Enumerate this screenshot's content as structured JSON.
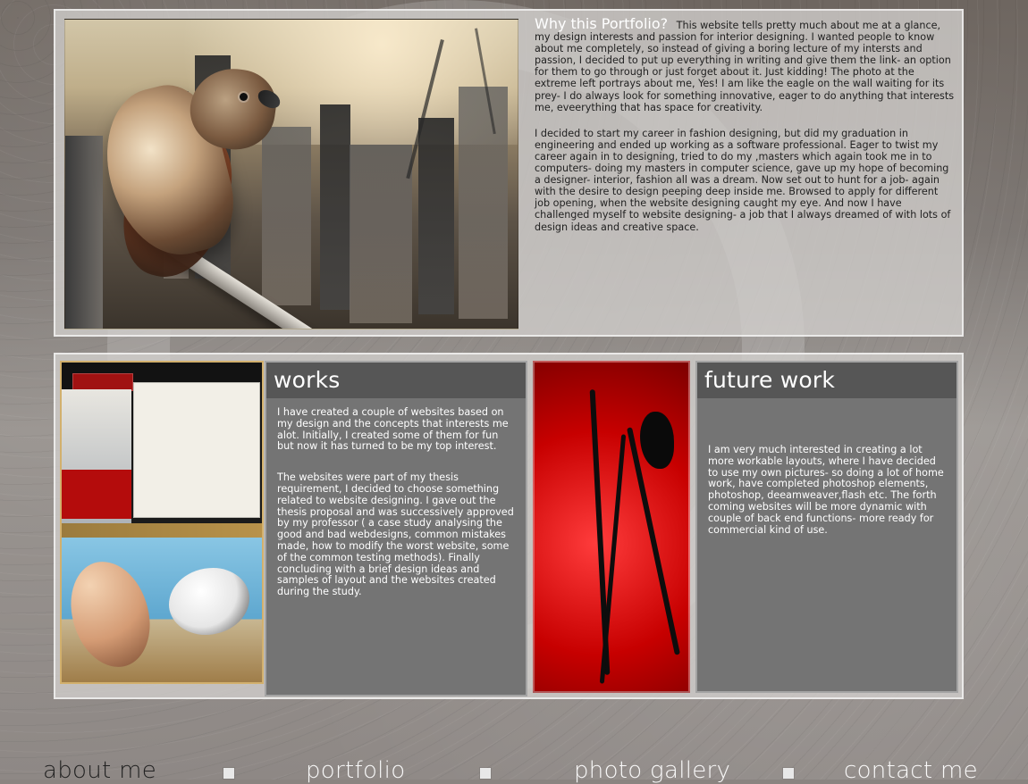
{
  "top": {
    "heading": "Why this Portfolio?",
    "para1": "This website tells pretty much about me at a glance, my design interests and passion for interior designing. I wanted people to know about me completely, so instead of giving a boring lecture of my intersts and passion, I decided to put up everything in writing and give them the link- an option for them to go through or just forget about it. Just kidding! The photo at the extreme left portrays about me, Yes! I am like the eagle on the wall waiting for its prey- I do always look for something innovative, eager to do anything that interests me, eveerything that has space for creativity.",
    "para2": "I decided to start my career in fashion designing, but did my graduation in engineering and ended up working as a software professional. Eager to twist my career again in to designing, tried to do my ,masters which again took me in to computers- doing my masters in computer science, gave up my hope of becoming a designer- interior, fashion all was a dream. Now set out to hunt for a job- again with the desire to design peeping deep inside me. Browsed to apply for different job opening, when the website designing caught my eye. And now I have challenged myself to website designing- a job that I always dreamed of with lots of design ideas and creative space."
  },
  "works": {
    "title": "works",
    "para1": "I have created a couple of websites based on my design and the concepts that interests me alot. Initially, I created some of them for fun but now it has turned to be my top interest.",
    "para2": "The websites were part of my thesis requirement, I decided to choose something related to website designing. I gave out the thesis proposal and was successively approved by my professor ( a case study analysing the good and bad webdesigns, common mistakes made, how to modify the worst website, some of the common testing methods). Finally concluding with a brief design ideas and samples of layout and the websites created during the study."
  },
  "future": {
    "title": "future work",
    "para1": "I am very much interested in creating a lot more workable layouts, where I have decided to use my own pictures- so doing a lot of home work, have completed photoshop elements, photoshop, deeamweaver,flash etc. The forth coming websites will be more dynamic with couple of back end functions- more ready for commercial kind of use."
  },
  "nav": {
    "about": "about me",
    "portfolio": "portfolio",
    "gallery": "photo gallery",
    "contact": "contact me"
  }
}
